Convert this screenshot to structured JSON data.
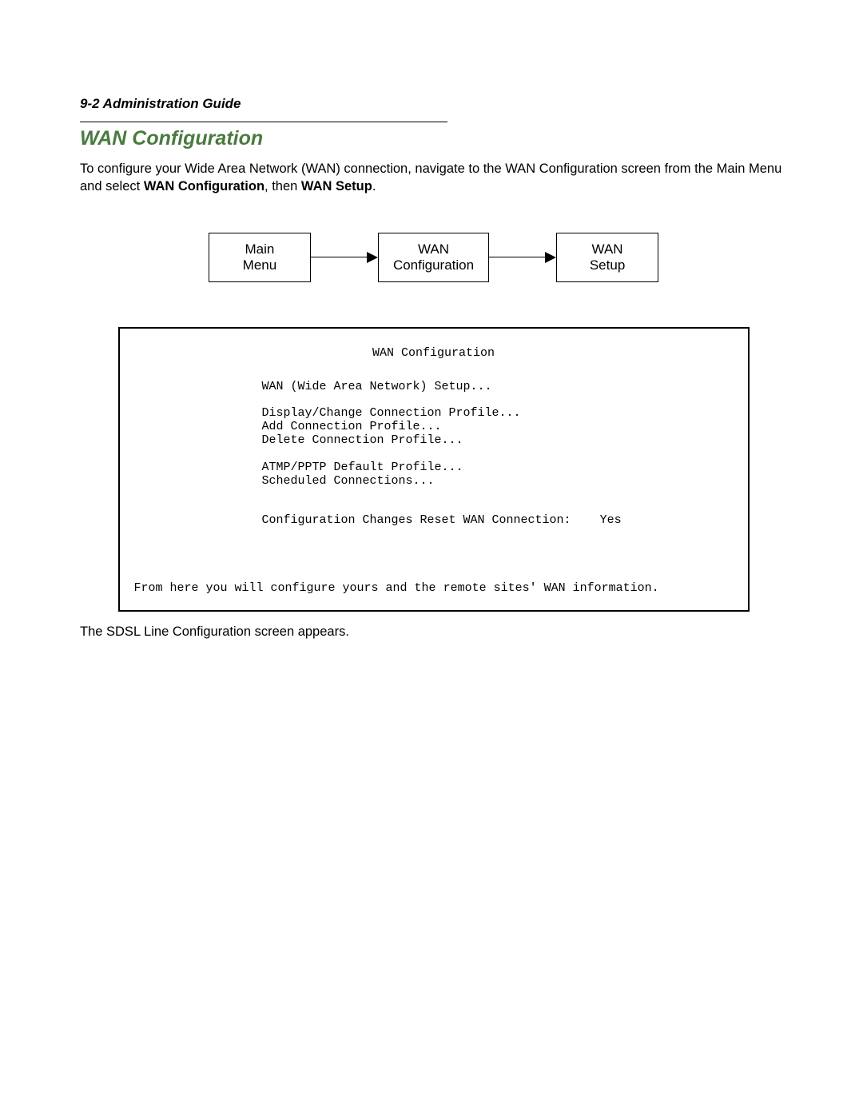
{
  "header": {
    "page_label": "9-2  Administration Guide"
  },
  "section": {
    "title": "WAN Configuration",
    "intro_pre": "To configure your Wide Area Network (WAN) connection, navigate to the WAN Configuration screen from the Main Menu and select ",
    "intro_bold1": "WAN Configuration",
    "intro_mid": ", then ",
    "intro_bold2": "WAN Setup",
    "intro_post": "."
  },
  "breadcrumb": {
    "box1_l1": "Main",
    "box1_l2": "Menu",
    "box2_l1": "WAN",
    "box2_l2": "Configuration",
    "box3_l1": "WAN",
    "box3_l2": "Setup"
  },
  "terminal": {
    "title": "WAN Configuration",
    "line_wan_setup": "WAN (Wide Area Network) Setup...",
    "line_display_change": "Display/Change Connection Profile...",
    "line_add_profile": "Add Connection Profile...",
    "line_delete_profile": "Delete Connection Profile...",
    "line_atmp": "ATMP/PPTP Default Profile...",
    "line_sched": "Scheduled Connections...",
    "line_config_reset": "Configuration Changes Reset WAN Connection:    Yes",
    "footer": "From here you will configure yours and the remote sites' WAN information."
  },
  "after": {
    "text": "The SDSL Line Configuration screen appears."
  }
}
